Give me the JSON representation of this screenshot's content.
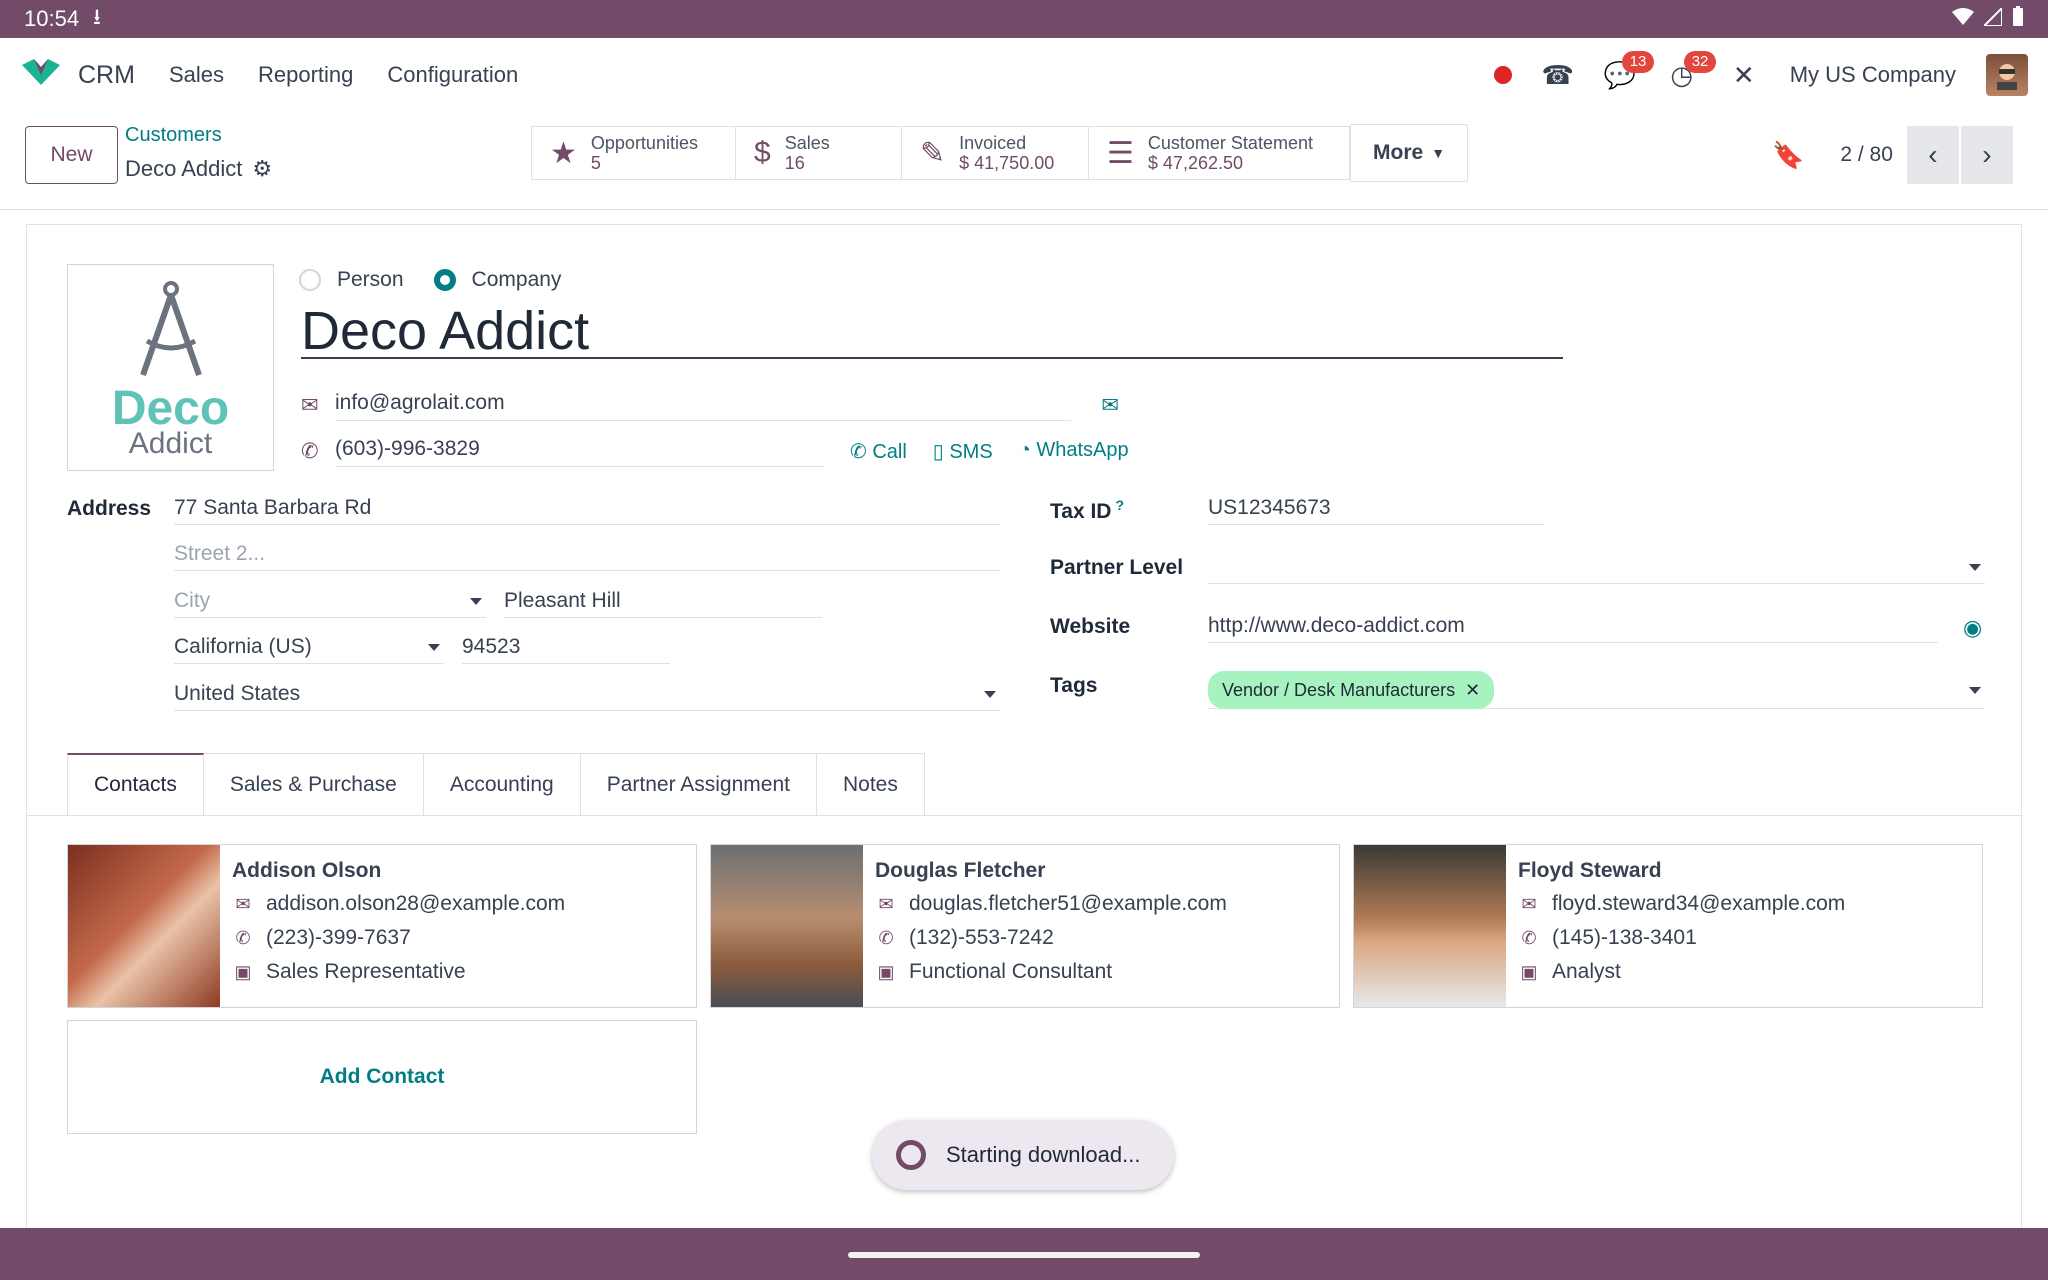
{
  "status_bar": {
    "time": "10:54"
  },
  "app": {
    "name": "CRM",
    "menu": [
      "Sales",
      "Reporting",
      "Configuration"
    ]
  },
  "systray": {
    "messages_count": "13",
    "activities_count": "32",
    "company": "My US Company"
  },
  "control_panel": {
    "new_label": "New",
    "breadcrumb": "Customers",
    "record_title": "Deco Addict",
    "smart_buttons": [
      {
        "label": "Opportunities",
        "value": "5",
        "icon": "star-icon"
      },
      {
        "label": "Sales",
        "value": "16",
        "icon": "dollar-icon"
      },
      {
        "label": "Invoiced",
        "value": "$ 41,750.00",
        "icon": "edit-icon"
      },
      {
        "label": "Customer Statement",
        "value": "$ 47,262.50",
        "icon": "list-icon"
      }
    ],
    "more_label": "More",
    "pager": "2 / 80"
  },
  "form": {
    "logo": {
      "line1": "Deco",
      "line2": "Addict"
    },
    "type_options": [
      "Person",
      "Company"
    ],
    "selected_type": "Company",
    "name": "Deco Addict",
    "email": "info@agrolait.com",
    "phone": "(603)-996-3829",
    "phone_actions": [
      "Call",
      "SMS",
      "WhatsApp"
    ],
    "address_label": "Address",
    "street": "77 Santa Barbara Rd",
    "street2_placeholder": "Street 2...",
    "city_placeholder": "City",
    "city": "Pleasant Hill",
    "state": "California (US)",
    "zip": "94523",
    "country": "United States",
    "tax_id_label": "Tax ID",
    "tax_id_help": "?",
    "tax_id": "US12345673",
    "partner_level_label": "Partner Level",
    "website_label": "Website",
    "website": "http://www.deco-addict.com",
    "tags_label": "Tags",
    "tags": [
      "Vendor / Desk Manufacturers"
    ]
  },
  "tabs": [
    "Contacts",
    "Sales & Purchase",
    "Accounting",
    "Partner Assignment",
    "Notes"
  ],
  "active_tab": "Contacts",
  "contacts": [
    {
      "name": "Addison Olson",
      "email": "addison.olson28@example.com",
      "phone": "(223)-399-7637",
      "job": "Sales Representative"
    },
    {
      "name": "Douglas Fletcher",
      "email": "douglas.fletcher51@example.com",
      "phone": "(132)-553-7242",
      "job": "Functional Consultant"
    },
    {
      "name": "Floyd Steward",
      "email": "floyd.steward34@example.com",
      "phone": "(145)-138-3401",
      "job": "Analyst"
    }
  ],
  "add_contact_label": "Add Contact",
  "toast": "Starting download...",
  "colors": {
    "primary": "#714b67",
    "accent": "#017e84",
    "tag_bg": "#a7f3c0",
    "badge": "#e3463f"
  }
}
